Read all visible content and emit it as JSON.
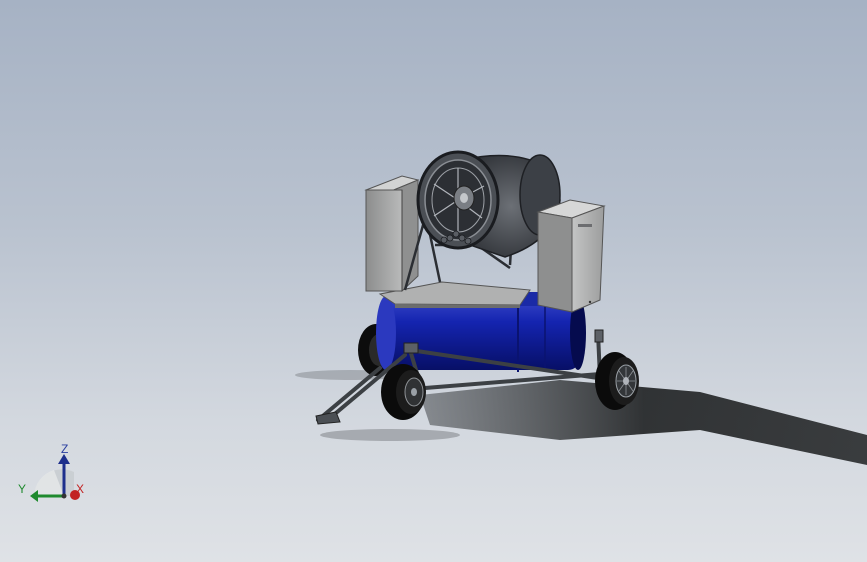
{
  "viewport": {
    "background_top": "#a6b2c4",
    "background_bottom": "#dfe2e6"
  },
  "model": {
    "body_color": "#0d1a9c",
    "housing_color": "#a9aaa9",
    "frame_color": "#4a4e52"
  },
  "triad": {
    "z_label": "Z",
    "y_label": "Y",
    "x_label": "X",
    "z_color": "#2a3fa0",
    "y_color": "#1f8a2e",
    "x_color": "#c22222"
  }
}
